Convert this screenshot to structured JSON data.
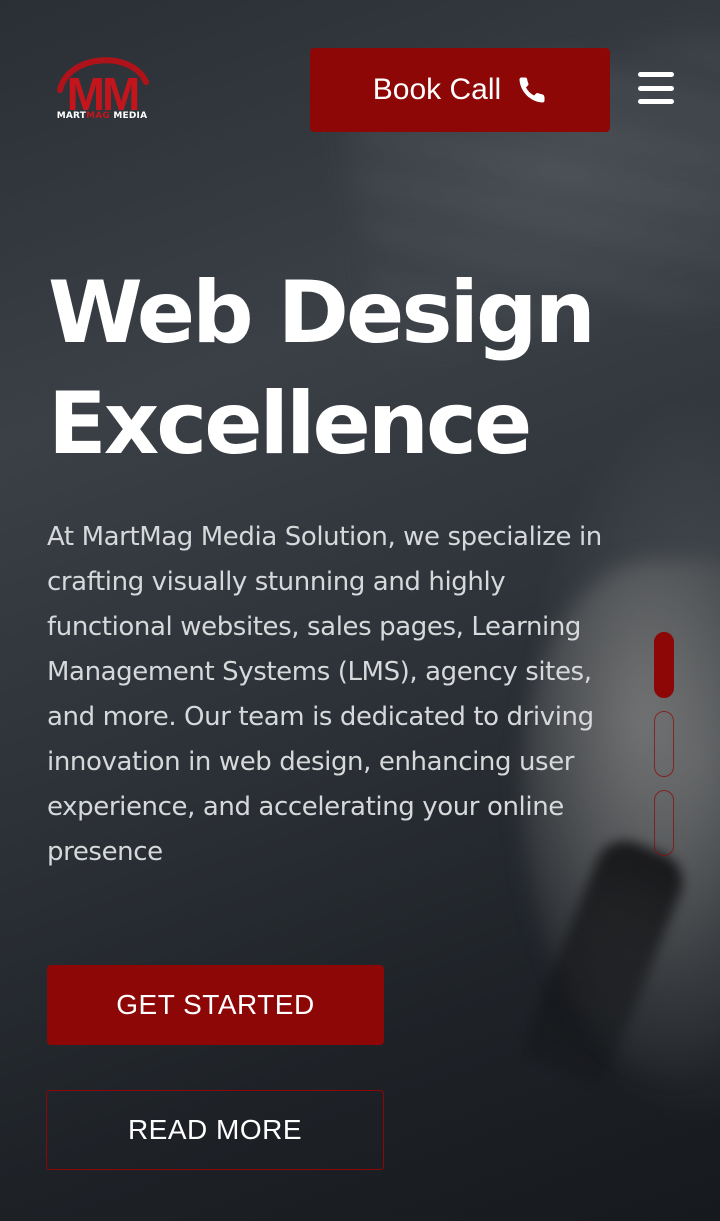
{
  "brand": {
    "logo_letters": "MM",
    "logo_tagline_part1": "MART",
    "logo_tagline_part2": "MAG",
    "logo_tagline_part3": "MEDIA",
    "accent_color": "#8d0707"
  },
  "header": {
    "book_call_label": "Book Call",
    "book_call_icon": "phone-icon",
    "menu_icon": "hamburger-menu-icon"
  },
  "hero": {
    "headline_line1": "Web Design",
    "headline_line2": "Excellence",
    "description": "At MartMag Media Solution, we specialize in crafting visually stunning and highly functional websites, sales pages, Learning Management Systems (LMS), agency sites, and more. Our team is dedicated to driving innovation in web design, enhancing user experience, and accelerating your online presence",
    "primary_button_label": "GET STARTED",
    "secondary_button_label": "READ MORE"
  },
  "slider": {
    "slide_count": 3,
    "active_slide": 1
  }
}
